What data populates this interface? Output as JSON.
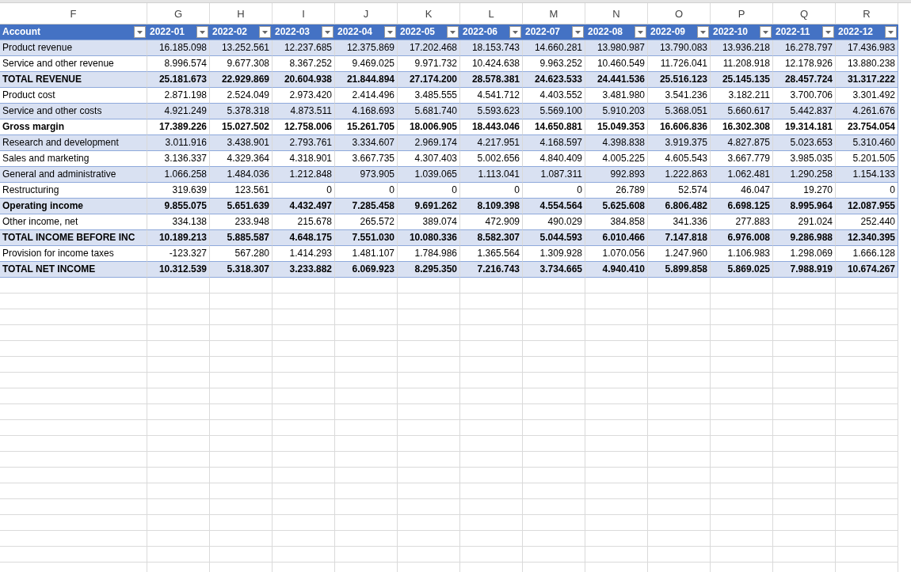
{
  "column_letters": [
    "F",
    "G",
    "H",
    "I",
    "J",
    "K",
    "L",
    "M",
    "N",
    "O",
    "P",
    "Q",
    "R"
  ],
  "table": {
    "columns": [
      "Account",
      "2022-01",
      "2022-02",
      "2022-03",
      "2022-04",
      "2022-05",
      "2022-06",
      "2022-07",
      "2022-08",
      "2022-09",
      "2022-10",
      "2022-11",
      "2022-12"
    ],
    "rows": [
      {
        "kind": "line",
        "account": "Product revenue",
        "values": [
          "16.185.098",
          "13.252.561",
          "12.237.685",
          "12.375.869",
          "17.202.468",
          "18.153.743",
          "14.660.281",
          "13.980.987",
          "13.790.083",
          "13.936.218",
          "16.278.797",
          "17.436.983"
        ]
      },
      {
        "kind": "line",
        "account": "Service and other revenue",
        "values": [
          "8.996.574",
          "9.677.308",
          "8.367.252",
          "9.469.025",
          "9.971.732",
          "10.424.638",
          "9.963.252",
          "10.460.549",
          "11.726.041",
          "11.208.918",
          "12.178.926",
          "13.880.238"
        ]
      },
      {
        "kind": "total",
        "account": "TOTAL REVENUE",
        "values": [
          "25.181.673",
          "22.929.869",
          "20.604.938",
          "21.844.894",
          "27.174.200",
          "28.578.381",
          "24.623.533",
          "24.441.536",
          "25.516.123",
          "25.145.135",
          "28.457.724",
          "31.317.222"
        ]
      },
      {
        "kind": "line",
        "account": "Product cost",
        "values": [
          "2.871.198",
          "2.524.049",
          "2.973.420",
          "2.414.496",
          "3.485.555",
          "4.541.712",
          "4.403.552",
          "3.481.980",
          "3.541.236",
          "3.182.211",
          "3.700.706",
          "3.301.492"
        ]
      },
      {
        "kind": "line",
        "account": "Service and other costs",
        "values": [
          "4.921.249",
          "5.378.318",
          "4.873.511",
          "4.168.693",
          "5.681.740",
          "5.593.623",
          "5.569.100",
          "5.910.203",
          "5.368.051",
          "5.660.617",
          "5.442.837",
          "4.261.676"
        ]
      },
      {
        "kind": "total",
        "account": "Gross margin",
        "values": [
          "17.389.226",
          "15.027.502",
          "12.758.006",
          "15.261.705",
          "18.006.905",
          "18.443.046",
          "14.650.881",
          "15.049.353",
          "16.606.836",
          "16.302.308",
          "19.314.181",
          "23.754.054"
        ]
      },
      {
        "kind": "line",
        "account": "Research and development",
        "values": [
          "3.011.916",
          "3.438.901",
          "2.793.761",
          "3.334.607",
          "2.969.174",
          "4.217.951",
          "4.168.597",
          "4.398.838",
          "3.919.375",
          "4.827.875",
          "5.023.653",
          "5.310.460"
        ]
      },
      {
        "kind": "line",
        "account": "Sales and marketing",
        "values": [
          "3.136.337",
          "4.329.364",
          "4.318.901",
          "3.667.735",
          "4.307.403",
          "5.002.656",
          "4.840.409",
          "4.005.225",
          "4.605.543",
          "3.667.779",
          "3.985.035",
          "5.201.505"
        ]
      },
      {
        "kind": "line",
        "account": "General and administrative",
        "values": [
          "1.066.258",
          "1.484.036",
          "1.212.848",
          "973.905",
          "1.039.065",
          "1.113.041",
          "1.087.311",
          "992.893",
          "1.222.863",
          "1.062.481",
          "1.290.258",
          "1.154.133"
        ]
      },
      {
        "kind": "line",
        "account": "Restructuring",
        "values": [
          "319.639",
          "123.561",
          "0",
          "0",
          "0",
          "0",
          "0",
          "26.789",
          "52.574",
          "46.047",
          "19.270",
          "0"
        ]
      },
      {
        "kind": "total",
        "account": "Operating income",
        "values": [
          "9.855.075",
          "5.651.639",
          "4.432.497",
          "7.285.458",
          "9.691.262",
          "8.109.398",
          "4.554.564",
          "5.625.608",
          "6.806.482",
          "6.698.125",
          "8.995.964",
          "12.087.955"
        ]
      },
      {
        "kind": "line",
        "account": "Other income, net",
        "values": [
          "334.138",
          "233.948",
          "215.678",
          "265.572",
          "389.074",
          "472.909",
          "490.029",
          "384.858",
          "341.336",
          "277.883",
          "291.024",
          "252.440"
        ]
      },
      {
        "kind": "total",
        "account": "TOTAL INCOME BEFORE INC",
        "values": [
          "10.189.213",
          "5.885.587",
          "4.648.175",
          "7.551.030",
          "10.080.336",
          "8.582.307",
          "5.044.593",
          "6.010.466",
          "7.147.818",
          "6.976.008",
          "9.286.988",
          "12.340.395"
        ]
      },
      {
        "kind": "line",
        "account": "Provision for income taxes",
        "values": [
          "-123.327",
          "567.280",
          "1.414.293",
          "1.481.107",
          "1.784.986",
          "1.365.564",
          "1.309.928",
          "1.070.056",
          "1.247.960",
          "1.106.983",
          "1.298.069",
          "1.666.128"
        ]
      },
      {
        "kind": "total",
        "account": "TOTAL NET INCOME",
        "values": [
          "10.312.539",
          "5.318.307",
          "3.233.882",
          "6.069.923",
          "8.295.350",
          "7.216.743",
          "3.734.665",
          "4.940.410",
          "5.899.858",
          "5.869.025",
          "7.988.919",
          "10.674.267"
        ]
      }
    ]
  }
}
